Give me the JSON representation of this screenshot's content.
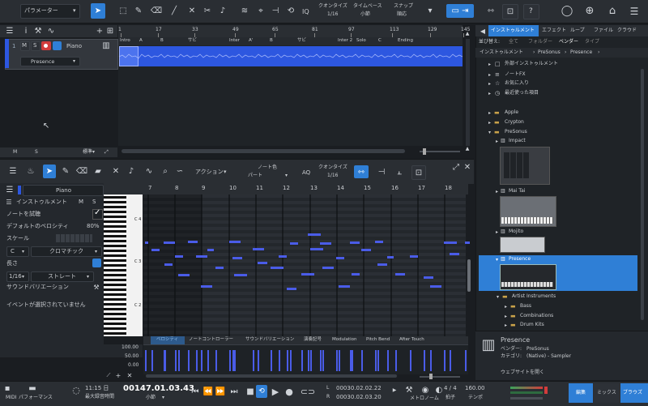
{
  "toolbar": {
    "param_dropdown": "パラメーター",
    "quantize_label": "クオンタイズ",
    "quantize_value": "1/16",
    "timebase_label": "タイムベース",
    "timebase_value": "小節",
    "snap_label": "スナップ",
    "snap_value": "順応",
    "iq_label": "IQ",
    "help_label": "?"
  },
  "track": {
    "number": "1",
    "name": "Piano",
    "instrument": "Presence",
    "m_label": "M",
    "s_label": "S",
    "bottom_m": "M",
    "bottom_s": "S",
    "bottom_std": "標準"
  },
  "arrange": {
    "ruler": [
      "1",
      "17",
      "33",
      "49",
      "65",
      "81",
      "97",
      "113",
      "129",
      "145"
    ],
    "markers": [
      "Intro",
      "A",
      "B",
      "サビ",
      "Inter",
      "A'",
      "B",
      "サビ",
      "Inter 2",
      "Solo",
      "C",
      "Ending"
    ]
  },
  "editor": {
    "action_label": "アクション",
    "note_color_label": "ノート色",
    "note_color_value": "パート",
    "aq_label": "AQ",
    "quantize_label": "クオンタイズ",
    "quantize_value": "1/16",
    "ruler": [
      "7",
      "8",
      "9",
      "10",
      "11",
      "12",
      "13",
      "14",
      "15",
      "16",
      "17",
      "18"
    ],
    "keys": [
      "C 4",
      "C 3",
      "C 2"
    ]
  },
  "inspector": {
    "track_name": "Piano",
    "instrument_label": "インストゥルメント",
    "m": "M",
    "s": "S",
    "note_preview": "ノートを試聴",
    "default_velocity": "デフォルトのベロシティ",
    "velocity_value": "80%",
    "scale_label": "スケール",
    "scale_root": "C",
    "scale_type": "クロマチック",
    "length_label": "長さ",
    "length_value": "1/16",
    "length_type": "ストレート",
    "sound_variation": "サウンドバリエーション",
    "no_selection": "イベントが選択されていません"
  },
  "lanes": {
    "tabs": [
      "ベロシティ",
      "ノートコントローラー",
      "サウンドバリエーション",
      "演奏記号",
      "Modulation",
      "Pitch Bend",
      "After Touch"
    ],
    "scale": [
      "100.00",
      "50.00",
      "0.00"
    ]
  },
  "browser": {
    "tabs": [
      "インストゥルメント",
      "エフェクト",
      "ループ",
      "ファイル",
      "クラウド"
    ],
    "sort_label": "並び替え:",
    "sort_options": [
      "全て",
      "フォルダー",
      "ベンダー",
      "タイプ"
    ],
    "breadcrumb": [
      "インストゥルメント",
      "PreSonus",
      "Presence"
    ],
    "top_items": [
      "外部インストゥルメント",
      "ノートFX",
      "お気に入り",
      "最近使った項目"
    ],
    "vendors": [
      "Apple",
      "Crypton",
      "PreSonus"
    ],
    "instruments": [
      "Impact",
      "Mai Tai",
      "Mojito",
      "Presence"
    ],
    "presets": [
      "Artist Instruments",
      "Bass",
      "Combinations",
      "Drum Kits"
    ],
    "info_name": "Presence",
    "info_vendor": "ベンダー:　PreSonus",
    "info_category": "カテゴリ:　(Native) - Sampler",
    "website": "ウェブサイトを開く"
  },
  "transport": {
    "midi": "MIDI",
    "performance": "パフォーマンス",
    "time": "11:15 日",
    "max_rec": "最大録音時間",
    "position": "00147.01.03.43",
    "position_unit": "小節",
    "left_locator": "00030.02.02.22",
    "right_locator": "00030.02.03.20",
    "l": "L",
    "r": "R",
    "metronome": "メトロノーム",
    "timesig": "4 / 4",
    "timesig_label": "拍子",
    "tempo": "160.00",
    "tempo_label": "テンポ",
    "edit": "編集",
    "mix": "ミックス",
    "browse": "ブラウズ"
  },
  "colors": {
    "accent": "#2f7fd6",
    "note": "#4a5ce8",
    "clip": "#2d57e0"
  }
}
